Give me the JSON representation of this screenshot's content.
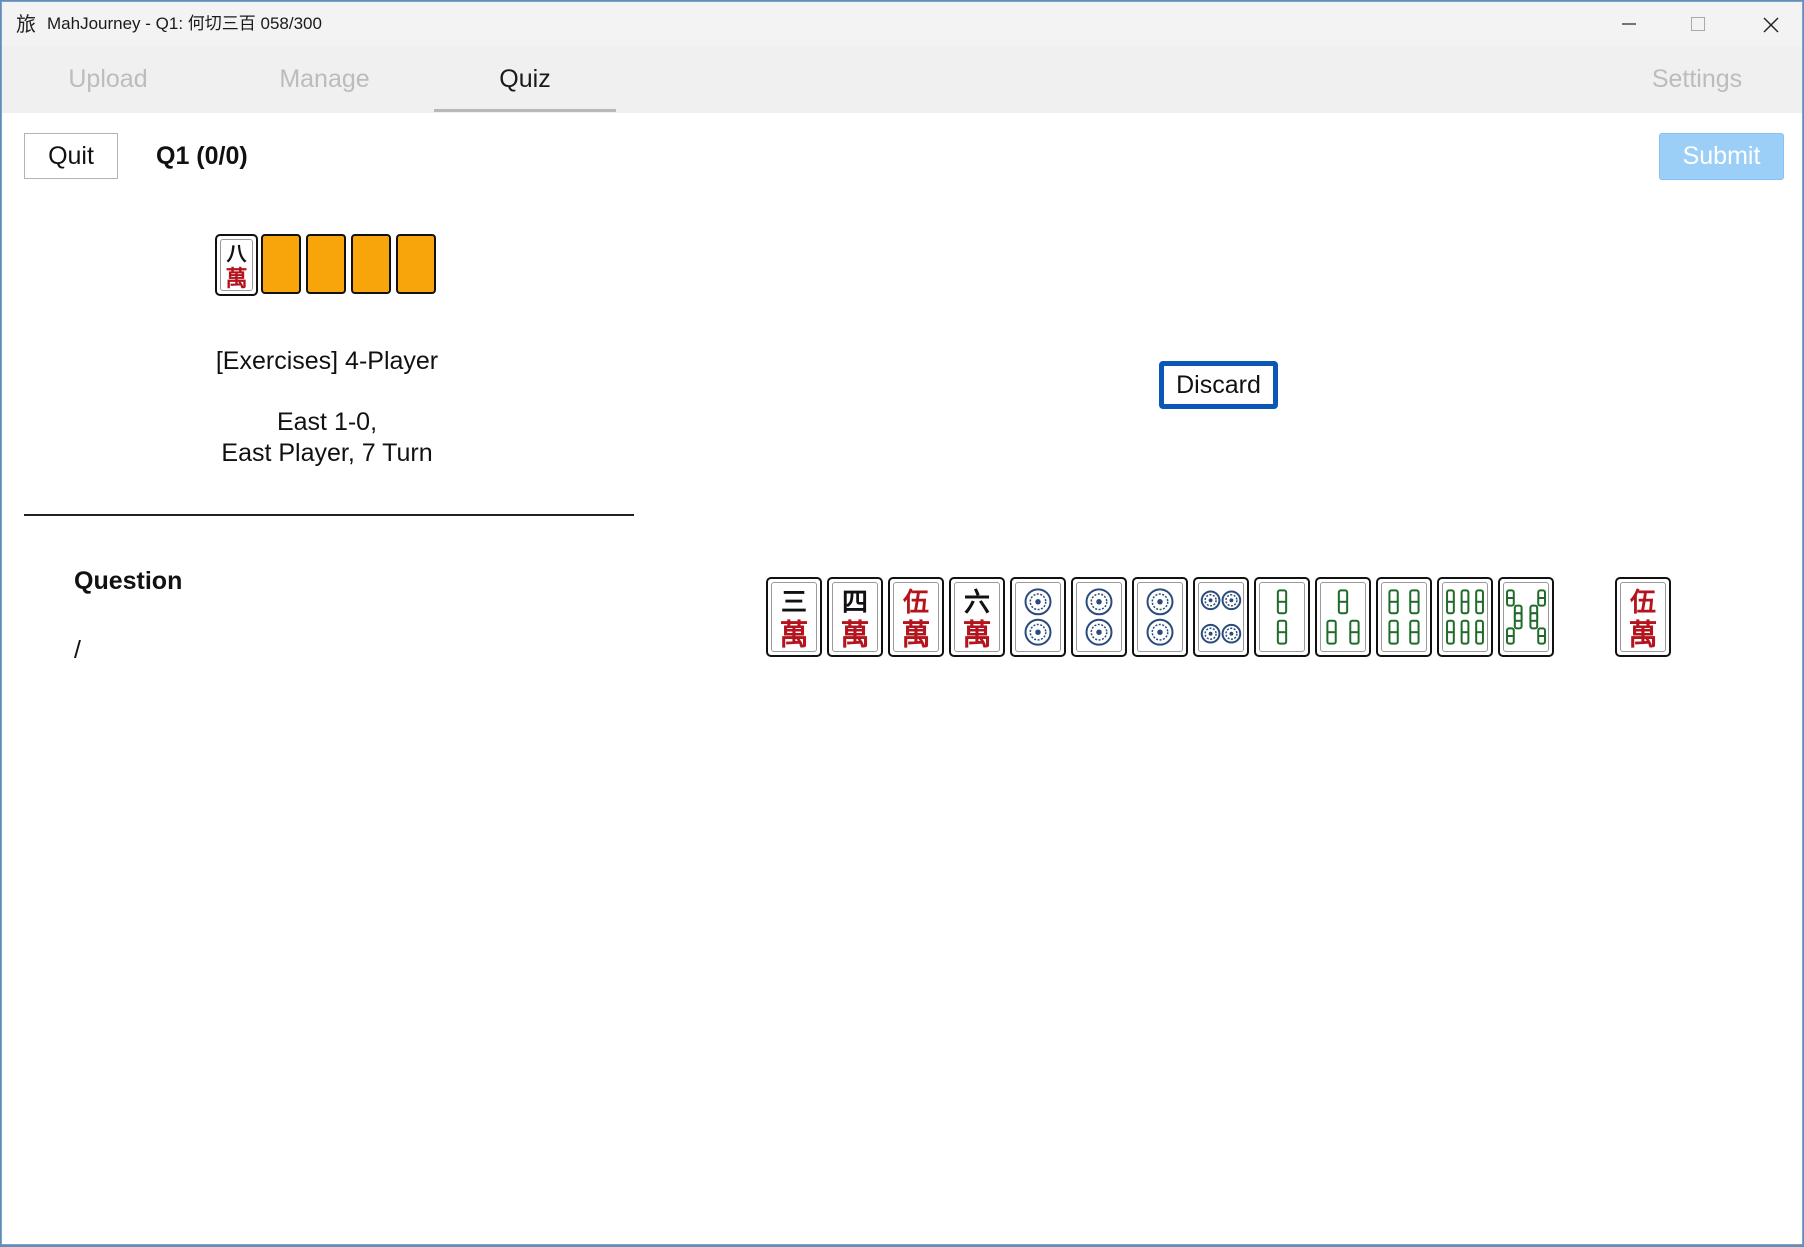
{
  "window": {
    "app_icon": "旅",
    "title": "MahJourney - Q1: 何切三百 058/300"
  },
  "tabs": [
    {
      "label": "Upload",
      "active": false
    },
    {
      "label": "Manage",
      "active": false
    },
    {
      "label": "Quiz",
      "active": true
    }
  ],
  "settings_tab": "Settings",
  "toolbar": {
    "quit_label": "Quit",
    "question_counter": "Q1 (0/0)",
    "submit_label": "Submit"
  },
  "dora": {
    "revealed_tile": {
      "suit": "man",
      "rank": 8,
      "rank_glyph": "八",
      "suit_glyph": "萬"
    },
    "hidden_count": 4,
    "hidden_color": "#f7a50b"
  },
  "game_info": {
    "mode": "[Exercises] 4-Player",
    "round": "East 1-0,",
    "seat": "East Player, 7 Turn"
  },
  "question": {
    "label": "Question",
    "text": "/"
  },
  "action": {
    "discard_label": "Discard"
  },
  "hand": {
    "tiles": [
      {
        "suit": "man",
        "rank": 3,
        "rank_glyph": "三",
        "suit_glyph": "萬"
      },
      {
        "suit": "man",
        "rank": 4,
        "rank_glyph": "四",
        "suit_glyph": "萬"
      },
      {
        "suit": "man",
        "rank": 5,
        "rank_glyph": "伍",
        "suit_glyph": "萬",
        "red": true
      },
      {
        "suit": "man",
        "rank": 6,
        "rank_glyph": "六",
        "suit_glyph": "萬"
      },
      {
        "suit": "pin",
        "rank": 2
      },
      {
        "suit": "pin",
        "rank": 2
      },
      {
        "suit": "pin",
        "rank": 2
      },
      {
        "suit": "pin",
        "rank": 4
      },
      {
        "suit": "sou",
        "rank": 2
      },
      {
        "suit": "sou",
        "rank": 3
      },
      {
        "suit": "sou",
        "rank": 4
      },
      {
        "suit": "sou",
        "rank": 6
      },
      {
        "suit": "sou",
        "rank": 8
      }
    ],
    "drawn_tile": {
      "suit": "man",
      "rank": 5,
      "rank_glyph": "伍",
      "suit_glyph": "萬",
      "red": true
    }
  },
  "colors": {
    "accent": "#0a57b8",
    "submit_disabled": "#9ccff7",
    "man_red": "#b3141d",
    "pin_blue": "#2a4b7c",
    "sou_green": "#1f6b2a"
  }
}
